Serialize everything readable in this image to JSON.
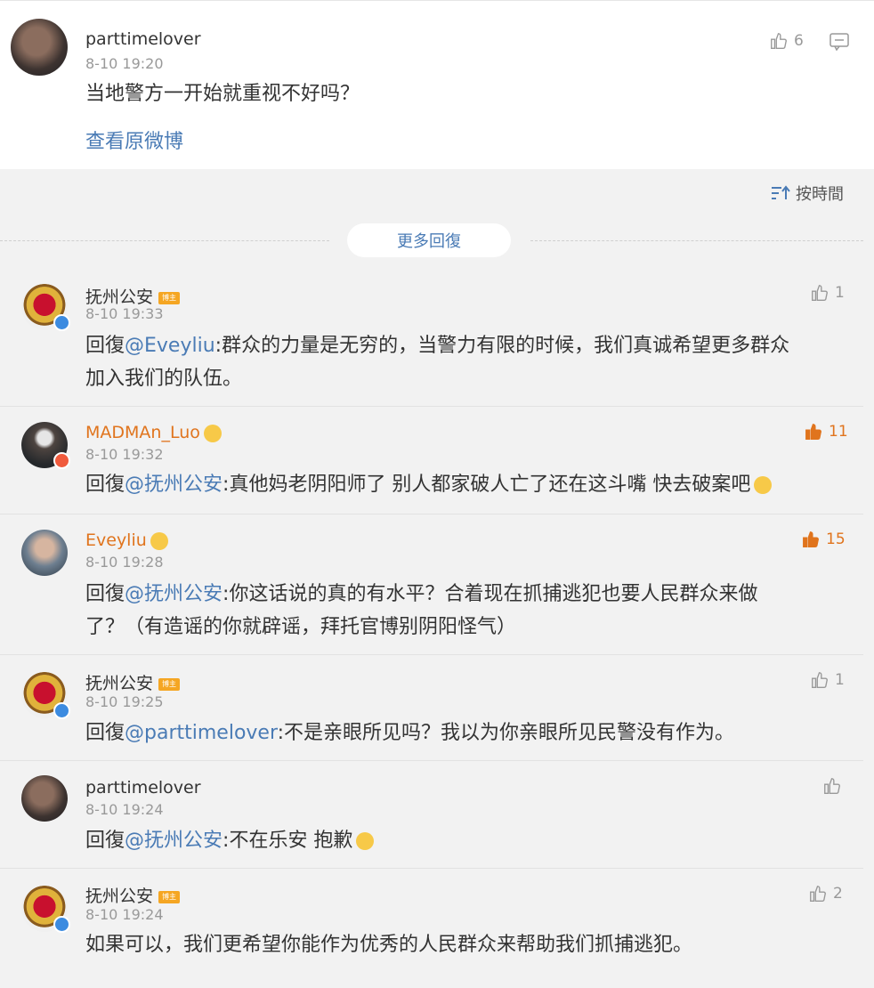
{
  "top_post": {
    "username": "parttimelover",
    "time": "8-10 19:20",
    "text": "当地警方一开始就重视不好吗？",
    "like_count": "6",
    "view_original": "查看原微博"
  },
  "sort_label": "按時間",
  "more_replies": "更多回復",
  "comments": [
    {
      "username": "抚州公安",
      "badge": "博主",
      "time": "8-10 19:33",
      "reply_prefix": "回復",
      "mention": "@Eveyliu",
      "text_line1": ":群众的力量是无穷的，当警力有限的时候，我们真诚希望更多群众",
      "text_line2": "加入我们的队伍。",
      "likes": "1"
    },
    {
      "username": "MADMAn_Luo",
      "time": "8-10 19:32",
      "reply_prefix": "回復",
      "mention": "@抚州公安",
      "text_line1": ":真他妈老阴阳师了 别人都家破人亡了还在这斗嘴 快去破案吧",
      "likes": "11"
    },
    {
      "username": "Eveyliu",
      "time": "8-10 19:28",
      "reply_prefix": "回復",
      "mention": "@抚州公安",
      "text_line1": ":你这话说的真的有水平？合着现在抓捕逃犯也要人民群众来做",
      "text_line2": "了？（有造谣的你就辟谣，拜托官博别阴阳怪气）",
      "likes": "15"
    },
    {
      "username": "抚州公安",
      "badge": "博主",
      "time": "8-10 19:25",
      "reply_prefix": "回復",
      "mention": "@parttimelover",
      "text_line1": ":不是亲眼所见吗？我以为你亲眼所见民警没有作为。",
      "likes": "1"
    },
    {
      "username": "parttimelover",
      "time": "8-10 19:24",
      "reply_prefix": "回復",
      "mention": "@抚州公安",
      "text_line1": ":不在乐安 抱歉",
      "likes": ""
    },
    {
      "username": "抚州公安",
      "badge": "博主",
      "time": "8-10 19:24",
      "text_line1": "如果可以，我们更希望你能作为优秀的人民群众来帮助我们抓捕逃犯。",
      "likes": "2"
    }
  ],
  "icons": {
    "like": "thumbs-up-icon",
    "comment": "comment-icon",
    "sort": "sort-icon"
  },
  "colors": {
    "link": "#4a7bb5",
    "accent": "#e0741d",
    "background": "#f2f2f2"
  }
}
